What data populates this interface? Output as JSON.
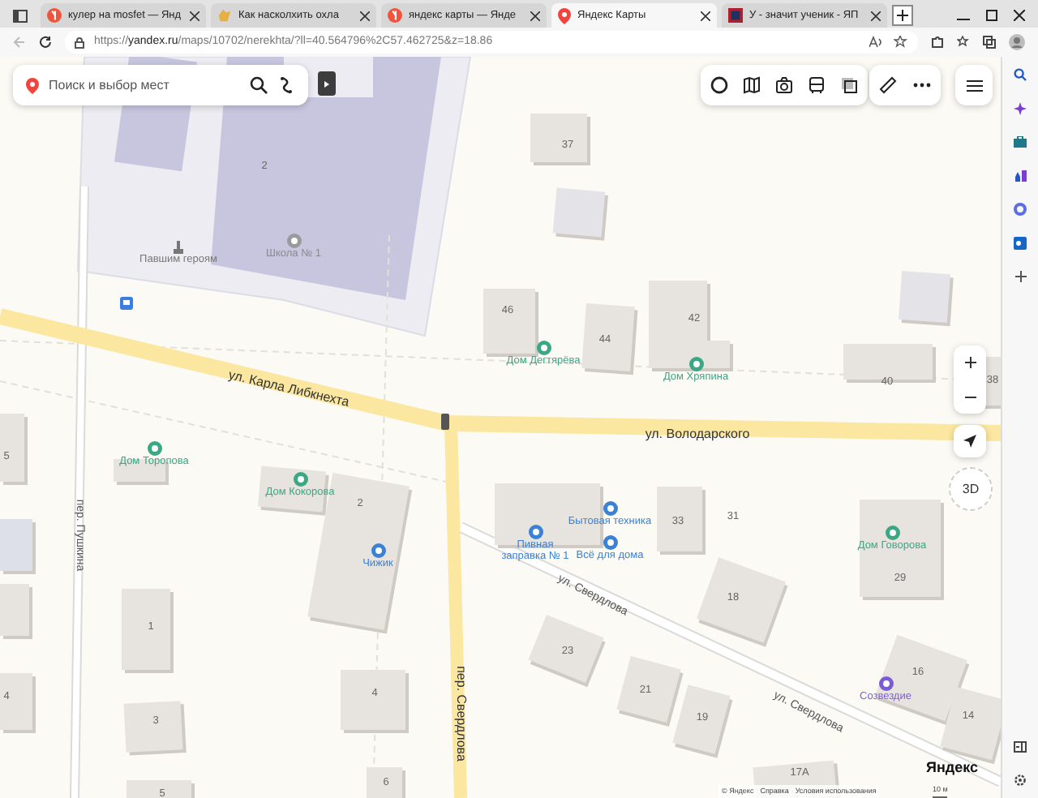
{
  "browser": {
    "tabs": [
      {
        "title": "кулер на mosfet — Янд",
        "selected": false,
        "kind": "yandex"
      },
      {
        "title": "Как насколхить охла",
        "selected": false,
        "kind": "other"
      },
      {
        "title": "яндекс карты — Янде",
        "selected": false,
        "kind": "yandex"
      },
      {
        "title": "Яндекс Карты",
        "selected": true,
        "kind": "maps"
      },
      {
        "title": "У - значит ученик - ЯП",
        "selected": false,
        "kind": "forum"
      }
    ],
    "address": {
      "scheme": "https://",
      "domain": "yandex.ru",
      "path": "/maps/10702/nerekhta/?ll=40.564796%2C57.462725&z=18.86"
    }
  },
  "map": {
    "search": {
      "placeholder": "Поиск и выбор мест"
    },
    "streets": [
      {
        "name": "ул. Карла Либкнехта",
        "kind": "main"
      },
      {
        "name": "ул. Володарского",
        "kind": "main"
      },
      {
        "name": "пер. Пушкина",
        "kind": "minor"
      },
      {
        "name": "пер. Свердлова",
        "kind": "main"
      },
      {
        "name": "ул. Свердлова",
        "kind": "minor"
      },
      {
        "name": "ул. Свердлова",
        "kind": "minor"
      }
    ],
    "places": [
      {
        "name": "Павшим героям",
        "kind": "monument"
      },
      {
        "name": "Школа № 1",
        "kind": "school"
      },
      {
        "name": "Дом Дегтярёва",
        "kind": "sight"
      },
      {
        "name": "Дом Хряпина",
        "kind": "sight"
      },
      {
        "name": "Дом Торопова",
        "kind": "sight"
      },
      {
        "name": "Дом Кокорова",
        "kind": "sight"
      },
      {
        "name": "Бытовая техника",
        "kind": "shop"
      },
      {
        "name": "Пивная заправка № 1",
        "kind": "shop"
      },
      {
        "name": "Всё для дома",
        "kind": "shop"
      },
      {
        "name": "Дом Говорова",
        "kind": "sight"
      },
      {
        "name": "Чижик",
        "kind": "shop"
      },
      {
        "name": "Созвездие",
        "kind": "leisure"
      }
    ],
    "house_numbers": [
      "37",
      "2",
      "46",
      "44",
      "42",
      "40",
      "38",
      "5",
      "2",
      "33",
      "31",
      "29",
      "18",
      "23",
      "21",
      "19",
      "1",
      "4",
      "16",
      "14",
      "3",
      "4",
      "17А",
      "6",
      "5"
    ],
    "compass": "3D",
    "logo": "Яндекс",
    "footer": [
      "© Яндекс",
      "Справка",
      "Условия использования"
    ],
    "scale": "10 м"
  }
}
